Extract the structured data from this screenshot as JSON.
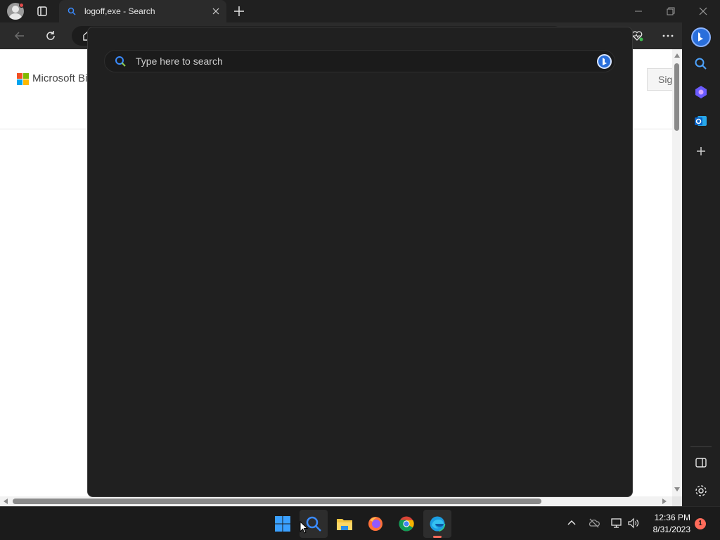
{
  "browser": {
    "tab": {
      "title": "logoff,exe - Search",
      "icon": "search-icon"
    },
    "toolbar": {
      "back_icon": "back-arrow-icon",
      "refresh_icon": "refresh-icon",
      "home_icon": "home-icon",
      "health_icon": "heart-pulse-icon",
      "more_icon": "more-icon"
    }
  },
  "page": {
    "brand": "Microsoft Bi",
    "signin_label": "Sig"
  },
  "sidebar": {
    "items": [
      "bing-copilot-icon",
      "search-icon",
      "copilot-icon",
      "outlook-icon",
      "add-icon",
      "split-screen-icon",
      "settings-icon"
    ]
  },
  "search_flyout": {
    "placeholder": "Type here to search",
    "bing_button": "bing-icon"
  },
  "taskbar": {
    "apps": [
      "windows-start-icon",
      "search-icon",
      "file-explorer-icon",
      "firefox-icon",
      "chrome-icon",
      "edge-icon"
    ],
    "tray": [
      "chevron-up-icon",
      "cloud-offline-icon",
      "network-icon",
      "volume-icon"
    ],
    "time": "12:36 PM",
    "date": "8/31/2023",
    "notification_count": "1"
  },
  "colors": {
    "flyout_bg": "#202020",
    "accent_blue": "#2a6fdb",
    "notification": "#ff6b5a"
  }
}
